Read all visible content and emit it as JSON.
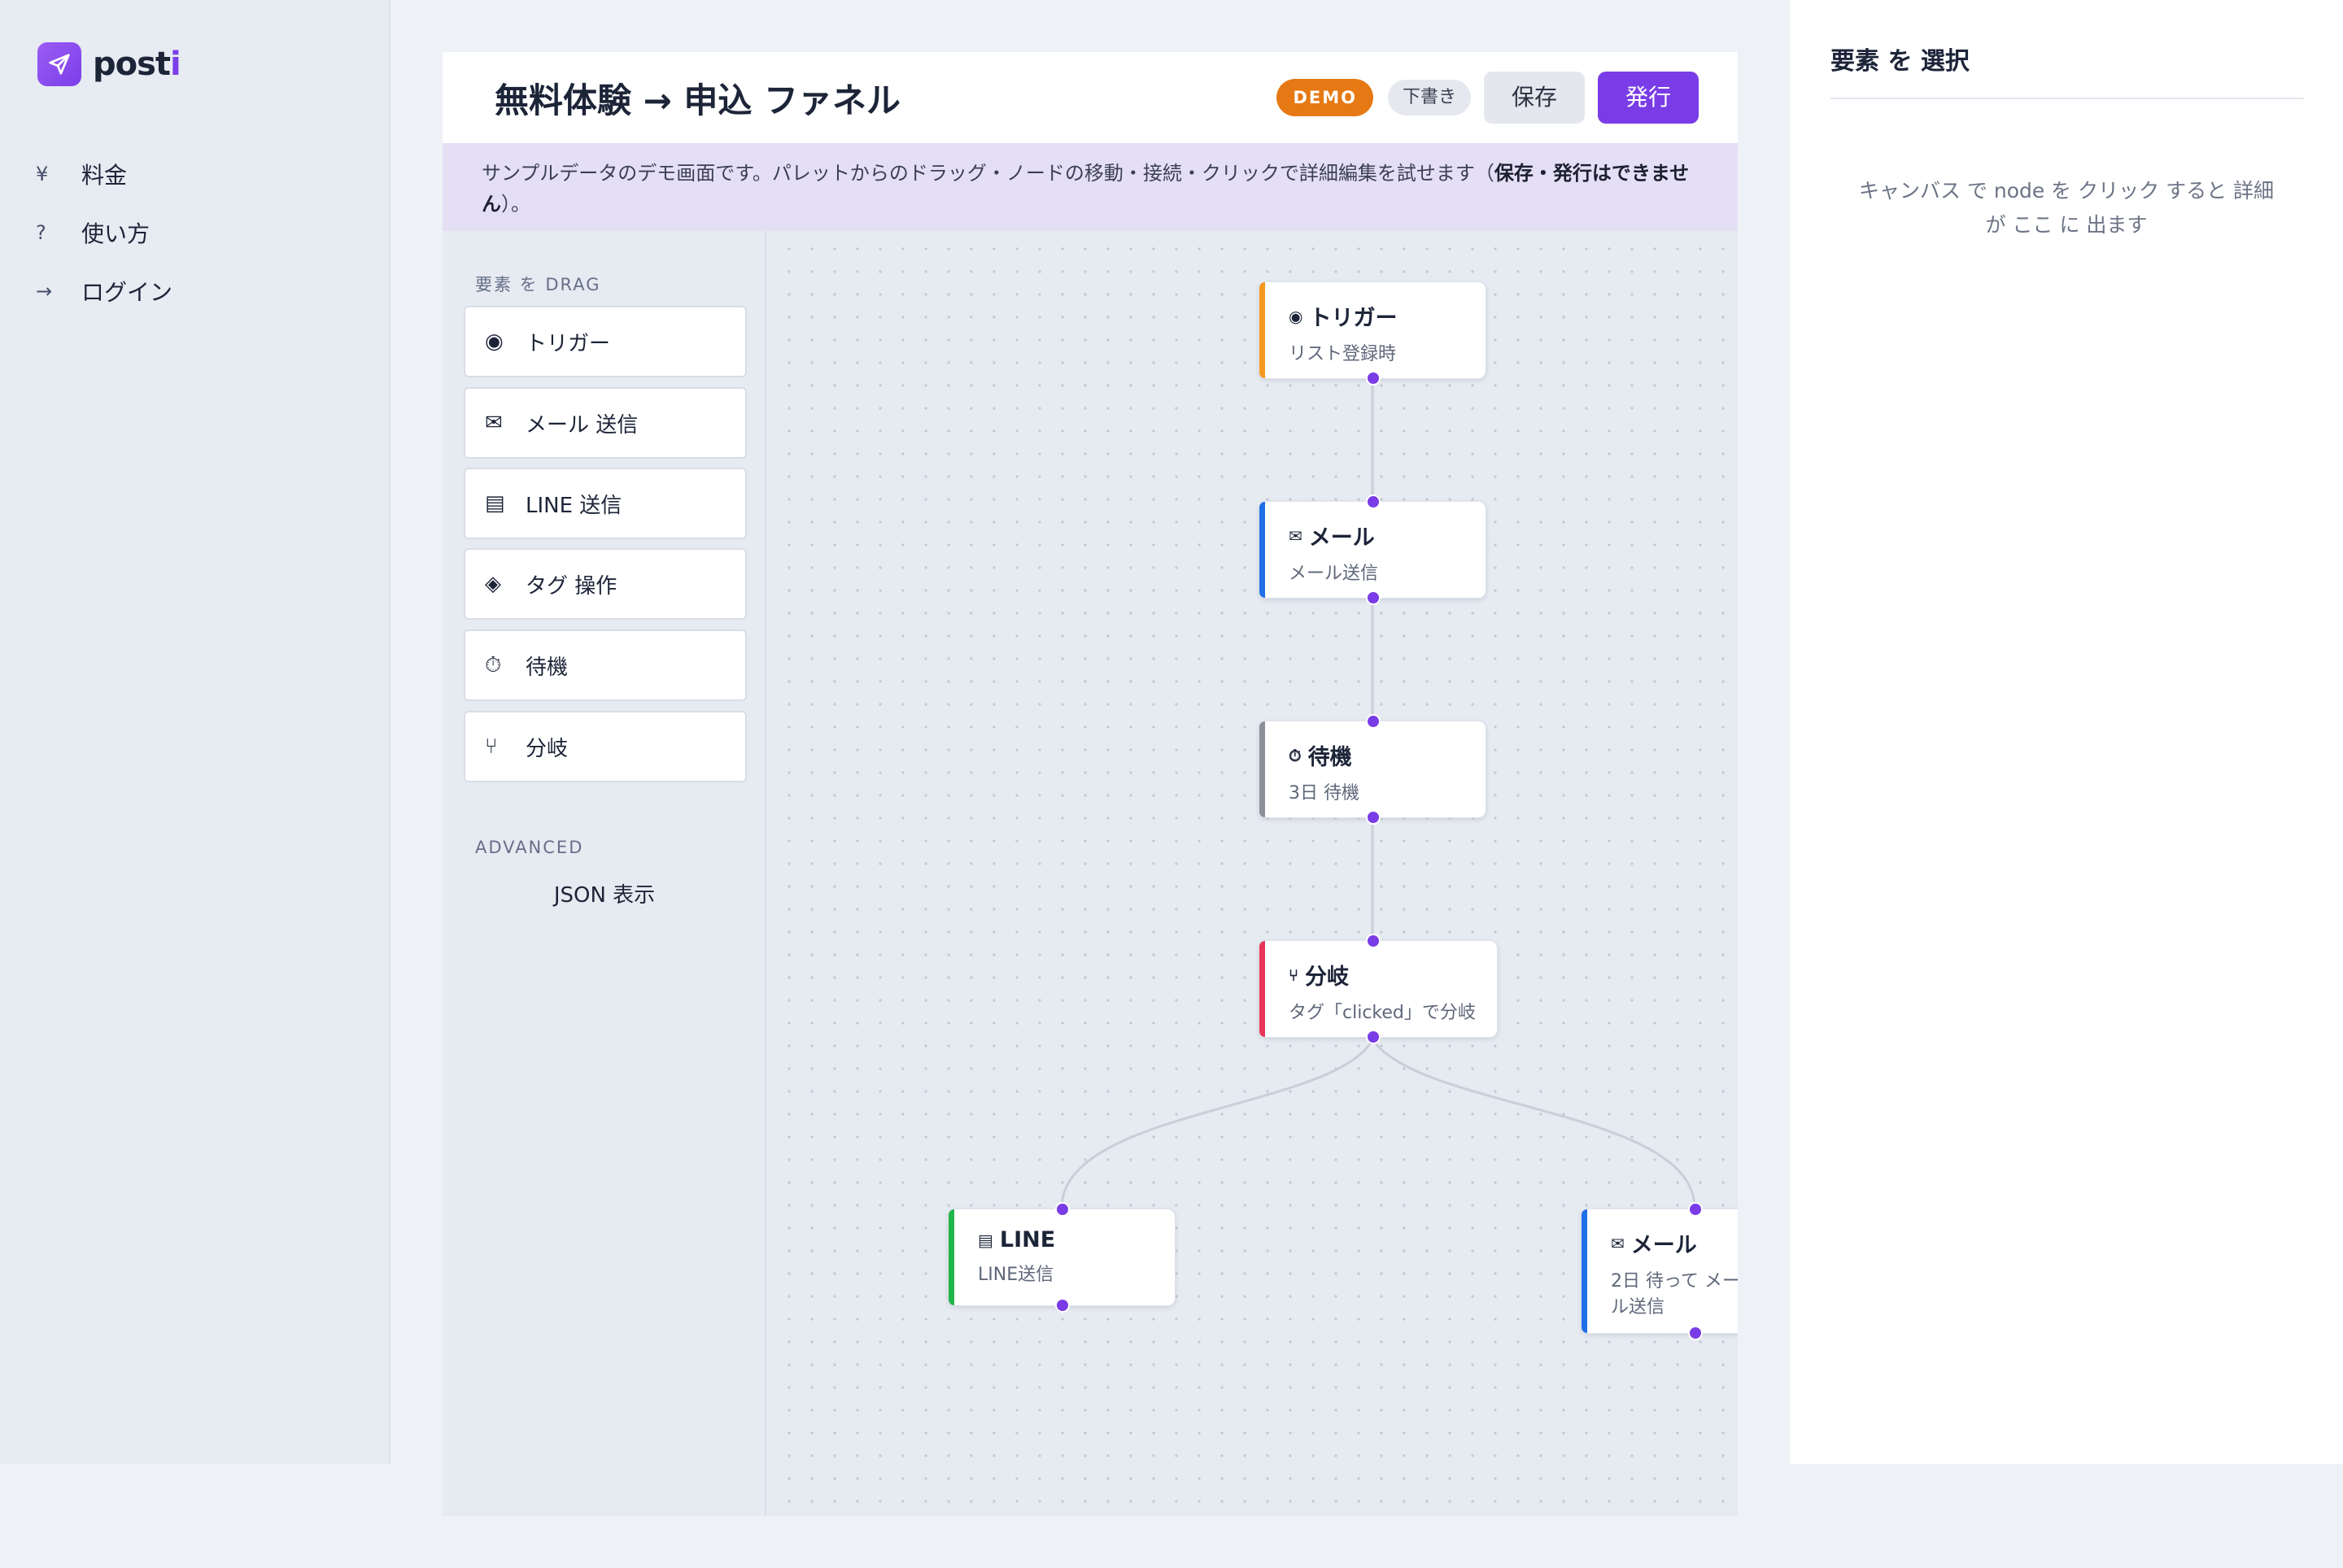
{
  "brand": {
    "name": "post",
    "name_accent": "i"
  },
  "nav": [
    {
      "icon": "¥",
      "label": "料金"
    },
    {
      "icon": "?",
      "label": "使い方"
    },
    {
      "icon": "→",
      "label": "ログイン"
    }
  ],
  "header": {
    "title": "無料体験 → 申込 ファネル",
    "demo_badge": "DEMO",
    "draft_badge": "下書き",
    "save_label": "保存",
    "publish_label": "発行"
  },
  "notice": {
    "text": "サンプルデータのデモ画面です。パレットからのドラッグ・ノードの移動・接続・クリックで詳細編集を試せます（",
    "bold": "保存・発行はできません",
    "tail": "）。"
  },
  "palette": {
    "section_label": "要素 を DRAG",
    "items": [
      {
        "icon": "◉",
        "label": "トリガー"
      },
      {
        "icon": "✉",
        "label": "メール 送信"
      },
      {
        "icon": "▤",
        "label": "LINE 送信"
      },
      {
        "icon": "◈",
        "label": "タグ 操作"
      },
      {
        "icon": "⏱",
        "label": "待機"
      },
      {
        "icon": "⑂",
        "label": "分岐"
      }
    ],
    "advanced_label": "ADVANCED",
    "json_label": "JSON 表示"
  },
  "nodes": [
    {
      "icon": "◉",
      "title": "トリガー",
      "sub": "リスト登録時",
      "accent": "#f39a1e"
    },
    {
      "icon": "✉",
      "title": "メール",
      "sub": "メール送信",
      "accent": "#1f6fe5"
    },
    {
      "icon": "⏱",
      "title": "待機",
      "sub": "3日 待機",
      "accent": "#8a8f99"
    },
    {
      "icon": "⑂",
      "title": "分岐",
      "sub": "タグ「clicked」で分岐",
      "accent": "#e8355a"
    },
    {
      "icon": "▤",
      "title": "LINE",
      "sub": "LINE送信",
      "accent": "#22b54a"
    },
    {
      "icon": "✉",
      "title": "メール",
      "sub": "2日 待って メール送信",
      "accent": "#1f6fe5"
    }
  ],
  "inspector": {
    "title": "要素 を 選択",
    "empty_text": "キャンバス で node を クリック すると 詳細 が ここ に 出ます"
  },
  "colors": {
    "brand": "#7a3ce6",
    "demo": "#e67914",
    "port": "#7a3ce6"
  }
}
